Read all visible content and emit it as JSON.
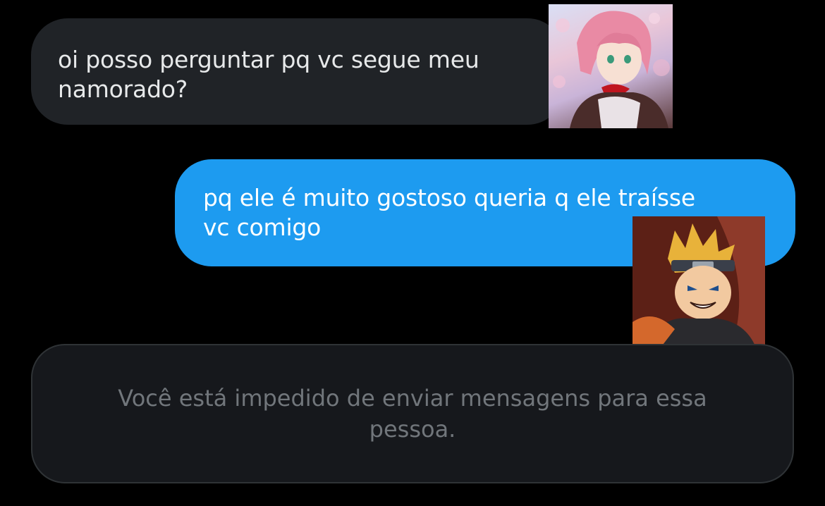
{
  "conversation": {
    "received_message": {
      "lines": [
        "oi posso perguntar pq vc segue meu",
        "namorado?"
      ],
      "bubble_color": "#202327",
      "text_color": "#e7e9ea"
    },
    "sent_message": {
      "lines": [
        "pq ele é muito gostoso queria q ele traísse",
        "vc comigo"
      ],
      "bubble_color": "#1d9bf0",
      "text_color": "#ffffff"
    },
    "avatars": {
      "received": "anime-pink-hair-avatar",
      "sent": "anime-blonde-hair-avatar"
    }
  },
  "composer": {
    "blocked_notice": "Você está impedido de enviar mensagens para essa pessoa.",
    "text_color": "#71767b"
  }
}
